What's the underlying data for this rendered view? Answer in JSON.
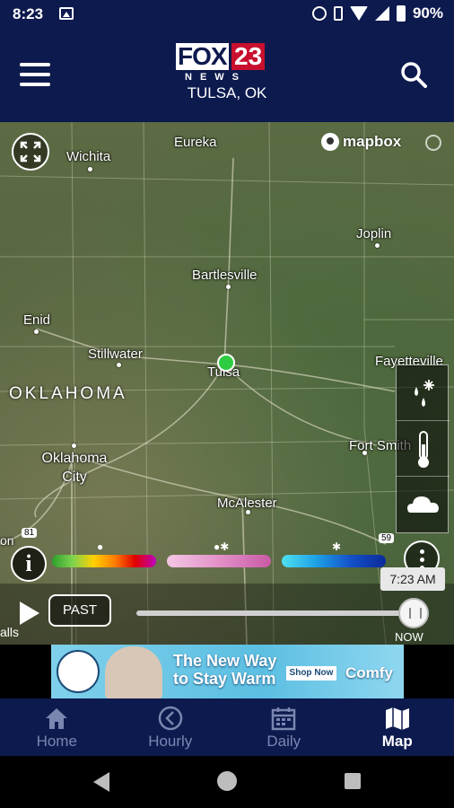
{
  "status_bar": {
    "time": "8:23",
    "battery": "90%"
  },
  "header": {
    "logo_fox": "FOX",
    "logo_number": "23",
    "logo_news": "NEWS",
    "location": "TULSA, OK"
  },
  "map": {
    "attribution": "mapbox",
    "state_label": "OKLAHOMA",
    "cities": [
      {
        "name": "Wichita"
      },
      {
        "name": "Eureka"
      },
      {
        "name": "Joplin"
      },
      {
        "name": "Bartlesville"
      },
      {
        "name": "Enid"
      },
      {
        "name": "Stillwater"
      },
      {
        "name": "Tulsa"
      },
      {
        "name": "Fayetteville"
      },
      {
        "name": "Fort Smith"
      },
      {
        "name": "Oklahoma City"
      },
      {
        "name": "McAlester"
      }
    ],
    "highway_labels": [
      "81",
      "59"
    ]
  },
  "radar": {
    "legend_groups": [
      "rain",
      "mix",
      "snow"
    ],
    "layers": [
      "precipitation-icon",
      "temperature-icon",
      "cloud-icon"
    ],
    "time_label": "7:23 AM",
    "past_label": "PAST",
    "now_label": "NOW",
    "edge_fragment": "alls",
    "left_edge_fragment": "on",
    "slider_position": 1.0
  },
  "ad": {
    "headline": "The New Way to Stay Warm",
    "cta": "Shop Now",
    "brand": "Comfy"
  },
  "bottom_nav": {
    "items": [
      {
        "label": "Home",
        "icon": "home-icon",
        "active": false
      },
      {
        "label": "Hourly",
        "icon": "clock-icon",
        "active": false
      },
      {
        "label": "Daily",
        "icon": "calendar-icon",
        "active": false
      },
      {
        "label": "Map",
        "icon": "map-icon",
        "active": true
      }
    ]
  },
  "colors": {
    "brand_navy": "#0d1a4e",
    "brand_red": "#c8102e",
    "location_green": "#2ecc40"
  }
}
